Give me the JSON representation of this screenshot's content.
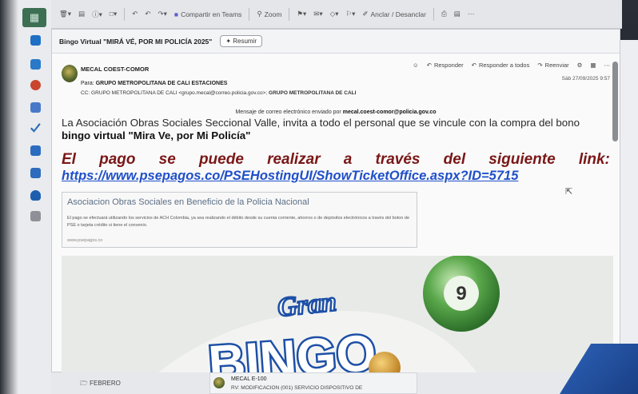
{
  "toolbar": {
    "teams_label": "Compartir en Teams",
    "zoom_label": "Zoom",
    "pin_label": "Anclar / Desanclar"
  },
  "email": {
    "subject": "Bingo Virtual \"MIRÁ VÉ, POR MI POLICÍA 2025\"",
    "summarize_label": "Resumir",
    "sender": "MECAL COEST-COMOR",
    "to_prefix": "Para:",
    "to": "GRUPO METROPOLITANA DE CALI ESTACIONES",
    "cc_prefix": "CC:",
    "cc_addr": "GRUPO METROPOLITANA DE CALI <grupo.mecal@correo.policia.gov.co>;",
    "cc_name": "GRUPO METROPOLITANA DE CALI",
    "reply_label": "Responder",
    "reply_all_label": "Responder a todos",
    "forward_label": "Reenviar",
    "date": "Sáb 27/09/2025 9:57",
    "sent_via_prefix": "Mensaje de correo electrónico enviado por",
    "sent_via_addr": "mecal.coest-comor@policia.gov.co"
  },
  "body": {
    "para1": "La Asociación Obras Sociales Seccional Valle, invita a todo el personal que se vincule con la compra del bono",
    "para1_strong": "bingo virtual \"Mira Ve, por Mi Policía\"",
    "pay_words": [
      "El",
      "pago",
      "se",
      "puede",
      "realizar",
      "a",
      "través",
      "del",
      "siguiente",
      "link:"
    ],
    "link": "https://www.psepagos.co/PSEHostingUI/ShowTicketOffice.aspx?ID=5715"
  },
  "preview_card": {
    "title": "Asociacion Obras Sociales en Beneficio de la Policia Nacional",
    "description": "El pago se efectuará utilizando los servicios de ACH Colombia, ya sea realizando el débito desde su cuenta corriente, ahorros o de depósitos electrónicos a través del boton de PSE o tarjeta crédito si tiene el convenio.",
    "url": "www.psepagos.co"
  },
  "banner": {
    "gran": "Gran",
    "bingo": "BINGO",
    "ball_number": "9"
  },
  "background": {
    "folder": "FEBRERO",
    "item_sender": "MECAL E-100",
    "item_preview": "RV: MODIFICACION (001) SERVICIO DISPOSITIVO DE"
  },
  "colors": {
    "link": "#1f4fc9",
    "pay_text": "#7a1717",
    "card_title": "#5c6f86",
    "banner_blue": "#1d4fa6"
  }
}
